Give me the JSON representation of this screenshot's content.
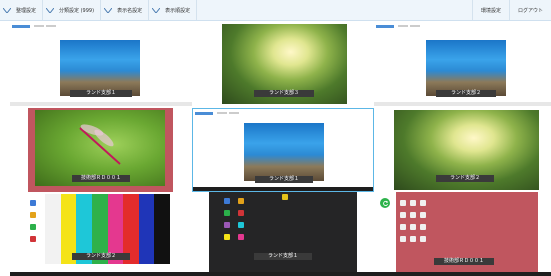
{
  "toolbar": {
    "left_buttons": [
      "整理設定",
      "分類設定 (999)",
      "表示名設定",
      "表示順設定"
    ],
    "right_buttons": [
      "環境設定",
      "ログアウト"
    ]
  },
  "tiles": [
    {
      "caption": "ランド支部１",
      "wallpaper": "white",
      "image": "ocean"
    },
    {
      "caption": "ランド支部３",
      "wallpaper": "dark",
      "image": "forest"
    },
    {
      "caption": "ランド支部２",
      "wallpaper": "white",
      "image": "ocean"
    },
    {
      "caption": "技術部ＲＤ００１",
      "wallpaper": "rose",
      "image": "dragonfly"
    },
    {
      "caption": "ランド支部１",
      "wallpaper": "white",
      "image": "ocean",
      "selected": true
    },
    {
      "caption": "ランド支部２",
      "wallpaper": "dark",
      "image": "forest"
    },
    {
      "caption": "ランド支部２",
      "wallpaper": "white",
      "image": "colorbars"
    },
    {
      "caption": "ランド支部１",
      "wallpaper": "dark",
      "image": "desktop"
    },
    {
      "caption": "技術部ＲＤ００１",
      "wallpaper": "rose",
      "image": "desktop"
    }
  ],
  "colors": {
    "accent": "#5cb7e6",
    "status": "#2db24a"
  },
  "icons": {
    "chevron": "chevron-down-icon",
    "status": "refresh-icon"
  }
}
